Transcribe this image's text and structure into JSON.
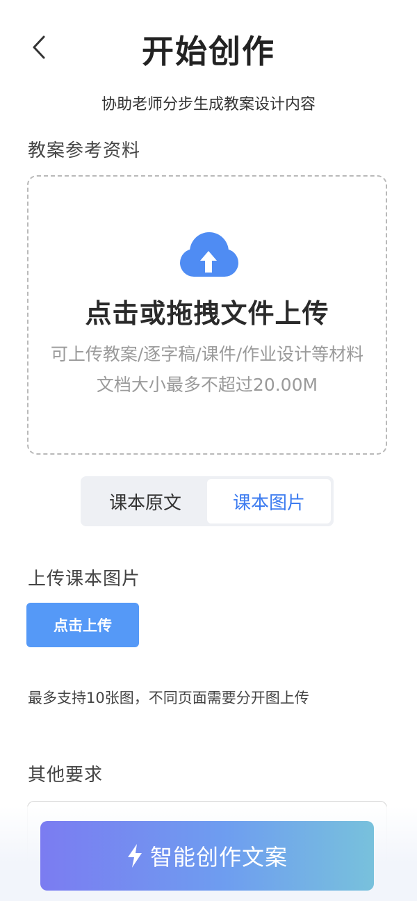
{
  "header": {
    "title": "开始创作",
    "subtitle": "协助老师分步生成教案设计内容",
    "back_icon": "chevron-left-icon"
  },
  "reference": {
    "section_label": "教案参考资料",
    "dropzone": {
      "icon": "cloud-upload-icon",
      "title": "点击或拖拽文件上传",
      "hint_line1": "可上传教案/逐字稿/课件/作业设计等材料",
      "hint_line2": "文档大小最多不超过20.00M"
    }
  },
  "tabs": {
    "items": [
      {
        "label": "课本原文",
        "active": false
      },
      {
        "label": "课本图片",
        "active": true
      }
    ]
  },
  "textbook_images": {
    "section_label": "上传课本图片",
    "upload_button": "点击上传",
    "note": "最多支持10张图，不同页面需要分开图上传"
  },
  "other": {
    "section_label": "其他要求"
  },
  "cta": {
    "icon": "lightning-icon",
    "label": "智能创作文案"
  },
  "colors": {
    "accent_blue": "#3d7cf0",
    "upload_button": "#5599f7",
    "cta_gradient_start": "#7b7cf1",
    "cta_gradient_end": "#78c1dc"
  }
}
